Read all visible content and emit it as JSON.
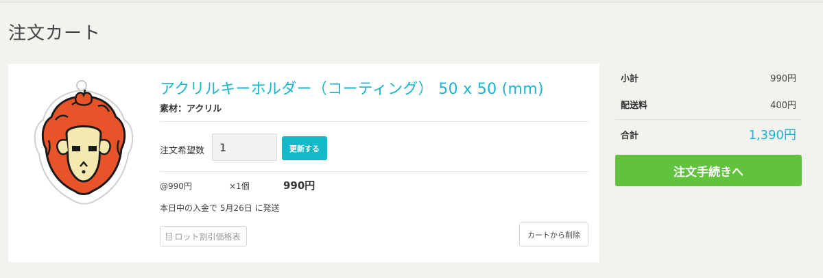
{
  "page": {
    "title": "注文カート"
  },
  "item": {
    "title": "アクリルキーホルダー（コーティング） 50 x 50 (mm)",
    "material": "素材：アクリル",
    "quantity_label": "注文希望数",
    "quantity_value": "1",
    "update_label": "更新する",
    "unit_price": "@990円",
    "qty_times": "×1個",
    "line_total": "990円",
    "shipping_note": "本日中の入金で 5月26日 に発送",
    "lot_discount_label": "ロット割引価格表",
    "remove_label": "カートから削除",
    "thumbnail_icon": "sheep-keychain-illustration"
  },
  "summary": {
    "subtotal_label": "小計",
    "subtotal_value": "990円",
    "shipping_label": "配送料",
    "shipping_value": "400円",
    "total_label": "合計",
    "total_value": "1,390円",
    "checkout_label": "注文手続きへ"
  },
  "colors": {
    "accent": "#19b5cf",
    "update_button": "#13b8c9",
    "checkout_button": "#61c33d",
    "page_background": "#f4f2ef"
  }
}
